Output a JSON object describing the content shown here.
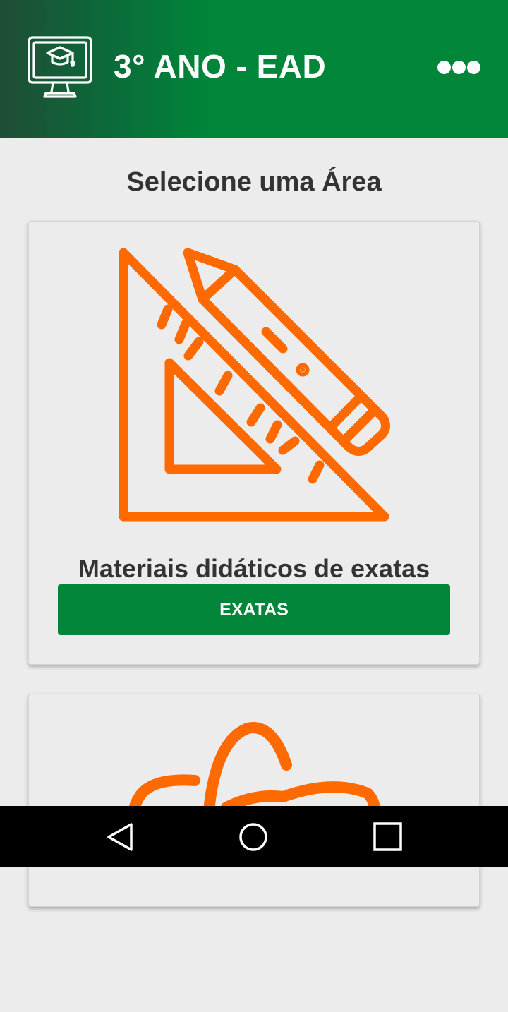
{
  "appbar": {
    "title": "3° ANO - EAD",
    "logo_icon": "monitor-graduation-cap-icon",
    "menu_icon": "more-horizontal-icon"
  },
  "section_title": "Selecione uma Área",
  "cards": [
    {
      "icon": "triangle-ruler-pencil-icon",
      "text": "Materiais didáticos de exatas",
      "button_label": "EXATAS"
    },
    {
      "icon": "atom-icon"
    }
  ],
  "navbar": {
    "back_icon": "back-triangle-icon",
    "home_icon": "home-circle-icon",
    "recents_icon": "recents-square-icon"
  },
  "colors": {
    "primary": "#008539",
    "accent": "#ff6a00",
    "background": "#ececec",
    "text": "#333333"
  }
}
